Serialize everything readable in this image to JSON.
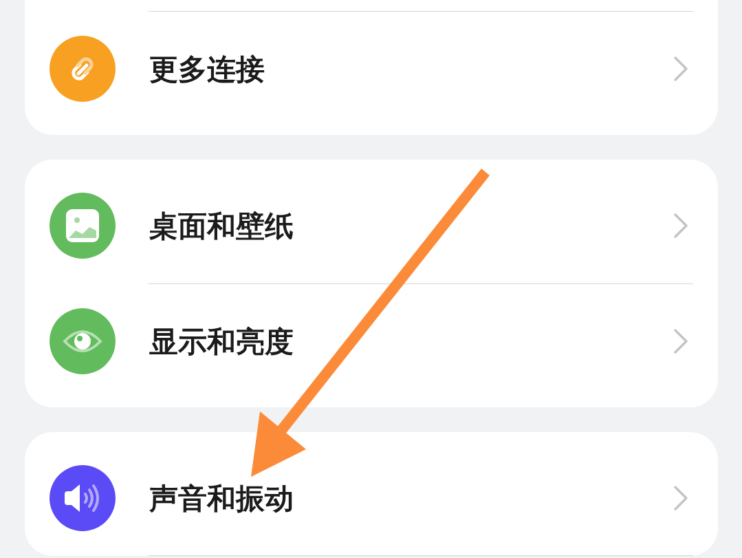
{
  "groups": [
    {
      "continued_above": true,
      "continued_below": false,
      "items": [
        {
          "label": "更多连接",
          "kind": "link"
        }
      ]
    },
    {
      "continued_above": false,
      "continued_below": false,
      "items": [
        {
          "label": "桌面和壁纸",
          "kind": "picture"
        },
        {
          "label": "显示和亮度",
          "kind": "eye"
        }
      ]
    },
    {
      "continued_above": false,
      "continued_below": true,
      "items": [
        {
          "label": "声音和振动",
          "kind": "speaker"
        }
      ]
    }
  ],
  "annotation": {
    "kind": "arrow"
  }
}
